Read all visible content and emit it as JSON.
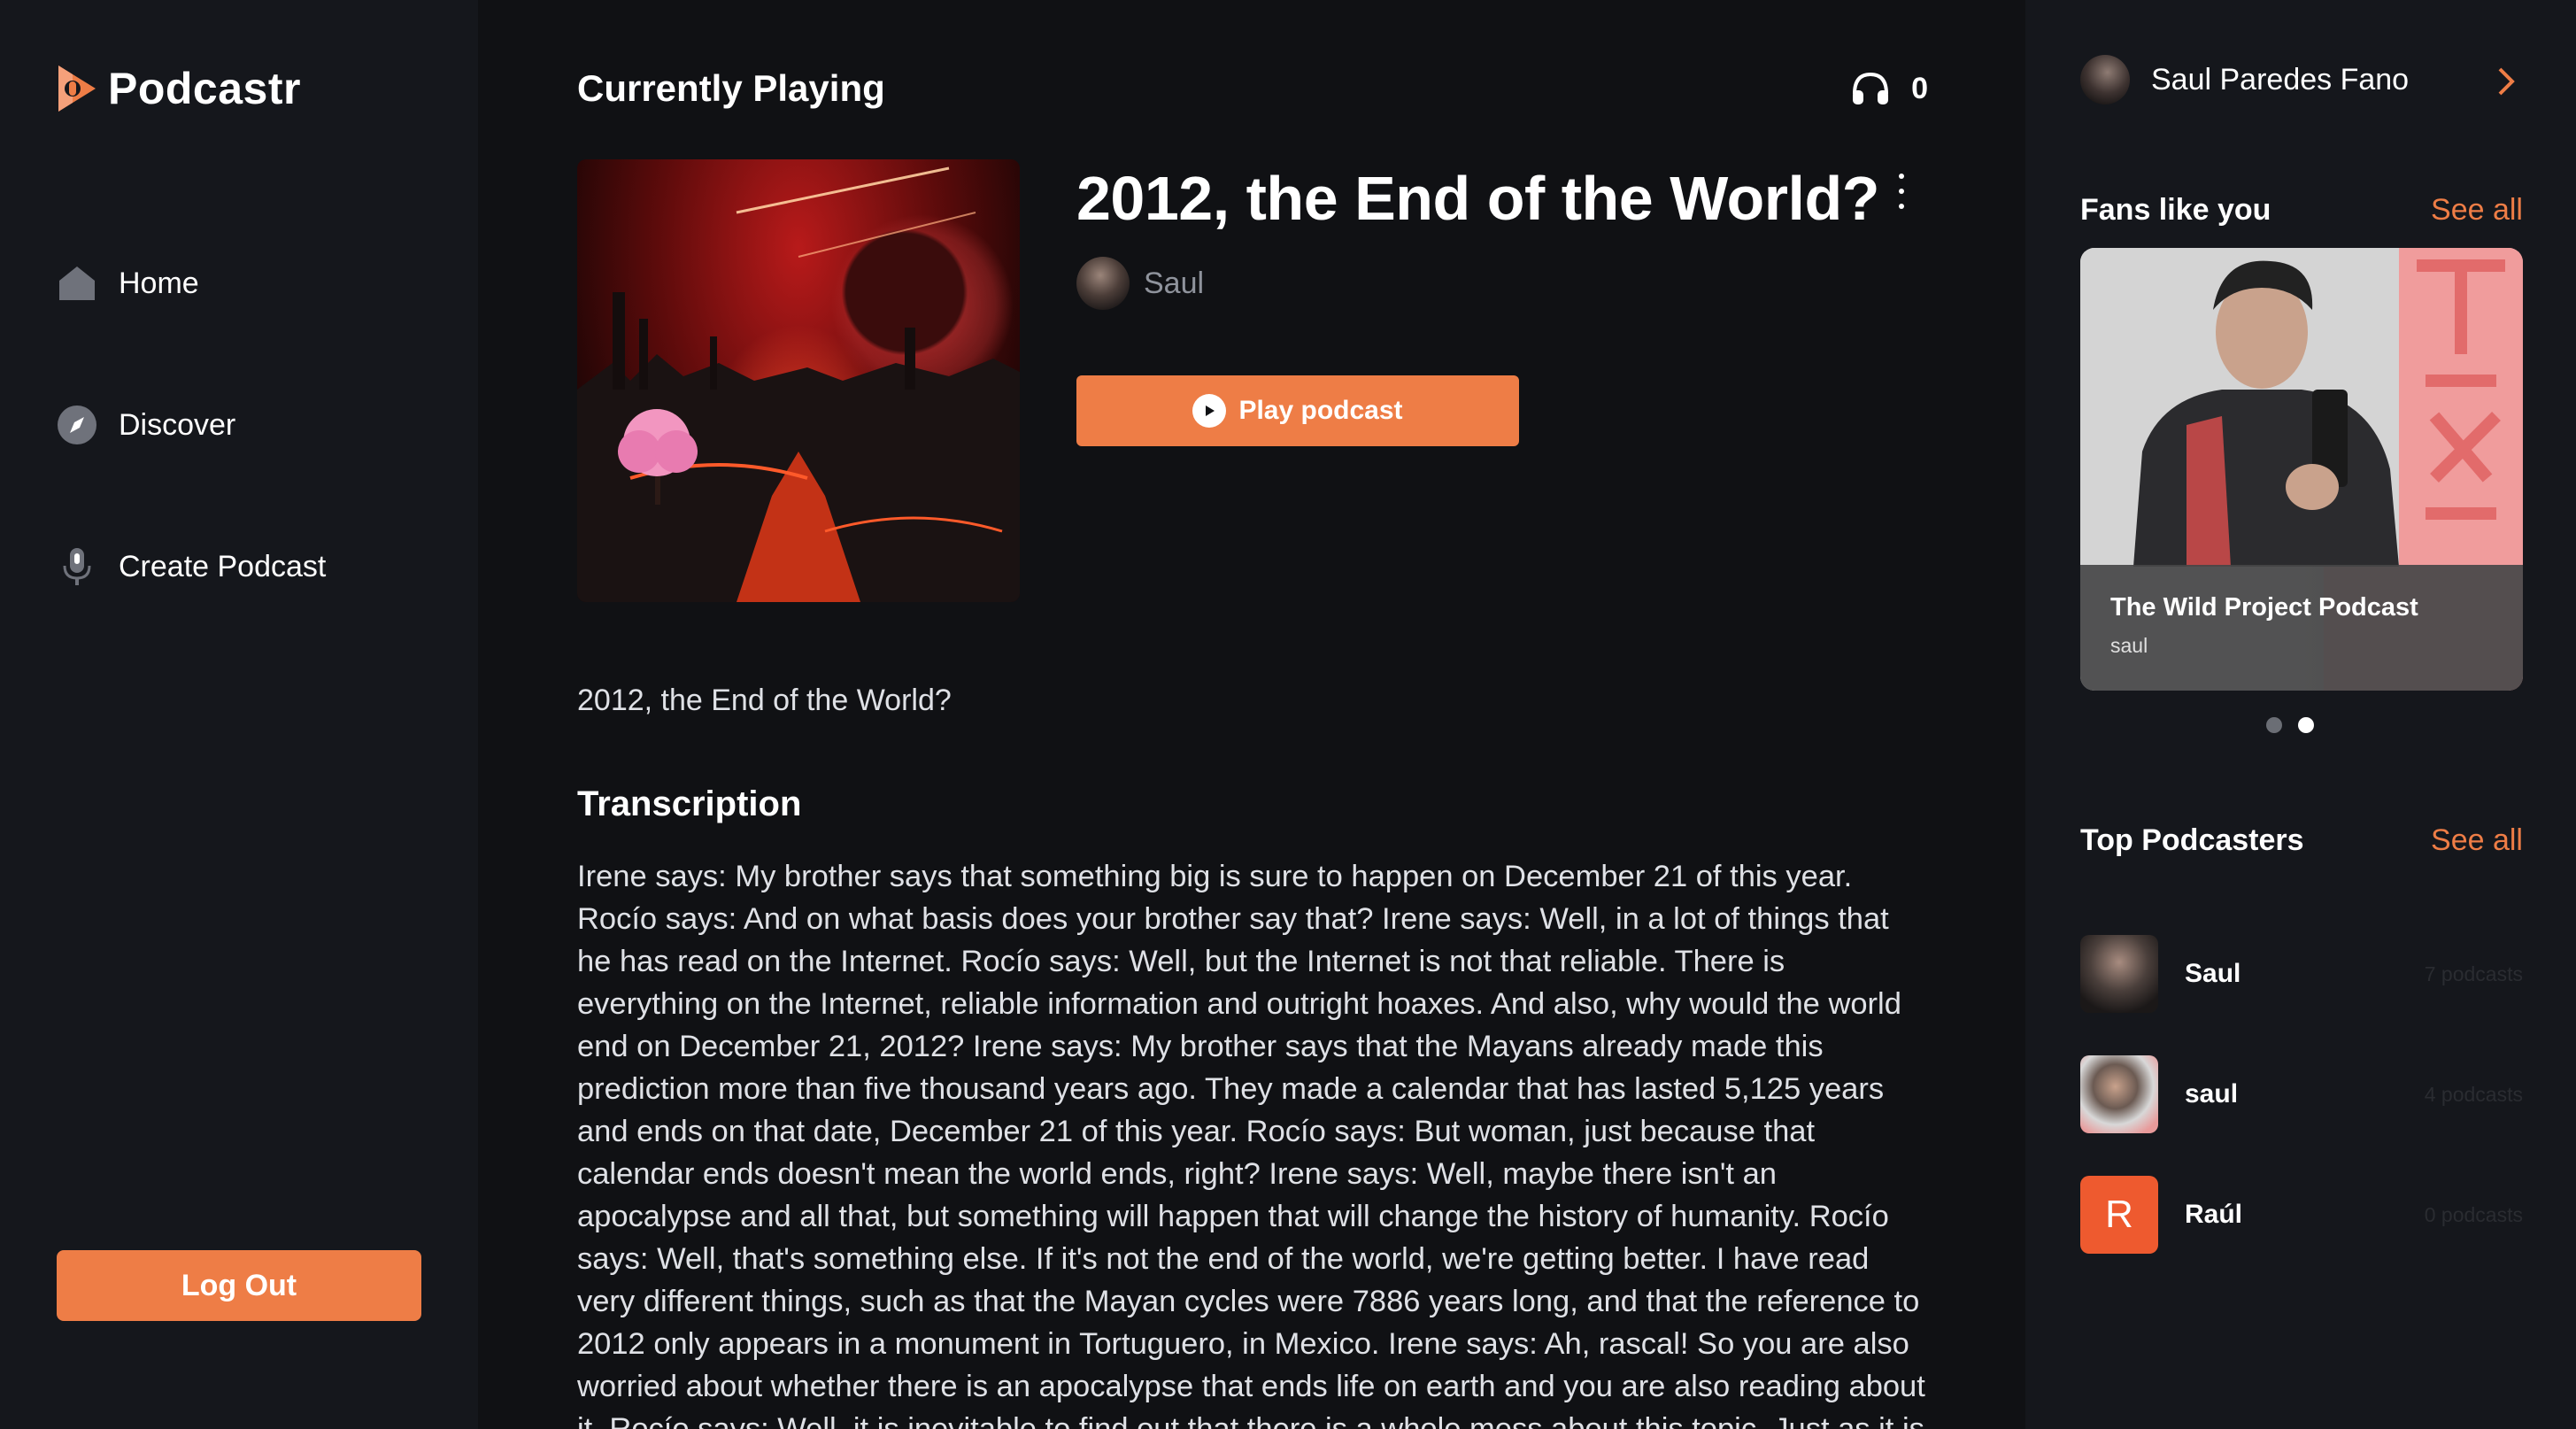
{
  "app": {
    "name": "Podcastr",
    "accent_color": "#ee7d46",
    "background_color": "#101114",
    "panel_color": "#15171c"
  },
  "sidebar": {
    "items": [
      {
        "label": "Home",
        "icon": "home-icon"
      },
      {
        "label": "Discover",
        "icon": "compass-icon"
      },
      {
        "label": "Create Podcast",
        "icon": "microphone-icon"
      }
    ],
    "logout_label": "Log Out"
  },
  "main": {
    "heading": "Currently Playing",
    "listeners": "0",
    "podcast_title": "2012, the End of the World?",
    "author": "Saul",
    "play_label": "Play podcast",
    "description": "2012, the End of the World?",
    "transcription_heading": "Transcription",
    "transcription": "Irene says: My brother says that something big is sure to happen on December 21 of this year. Rocío says: And on what basis does your brother say that? Irene says: Well, in a lot of things that he has read on the Internet. Rocío says: Well, but the Internet is not that reliable. There is everything on the Internet, reliable information and outright hoaxes. And also, why would the world end on December 21, 2012? Irene says: My brother says that the Mayans already made this prediction more than five thousand years ago. They made a calendar that has lasted 5,125 years and ends on that date, December 21 of this year. Rocío says: But woman, just because that calendar ends doesn't mean the world ends, right? Irene says: Well, maybe there isn't an apocalypse and all that, but something will happen that will change the history of humanity. Rocío says: Well, that's something else. If it's not the end of the world, we're getting better. I have read very different things, such as that the Mayan cycles were 7886 years long, and that the reference to 2012 only appears in a monument in Tortuguero, in Mexico. Irene says: Ah, rascal! So you are also worried about whether there is an apocalypse that ends life on earth and you are also reading about it. Rocío says: Well, it is inevitable to find out that there is a whole mess about this topic. Just as it is also inevitable to observe the number of people who are"
  },
  "right": {
    "user_name": "Saul Paredes Fano",
    "fans_heading": "Fans like you",
    "fans_see_all": "See all",
    "fan_card": {
      "title": "The Wild Project Podcast",
      "author": "saul"
    },
    "carousel": {
      "count": 2,
      "active": 2
    },
    "top_heading": "Top Podcasters",
    "top_see_all": "See all",
    "podcasters": [
      {
        "name": "Saul",
        "count": "7 podcasts"
      },
      {
        "name": "saul",
        "count": "4 podcasts"
      },
      {
        "name": "Raúl",
        "count": "0 podcasts",
        "initial": "R"
      }
    ]
  }
}
